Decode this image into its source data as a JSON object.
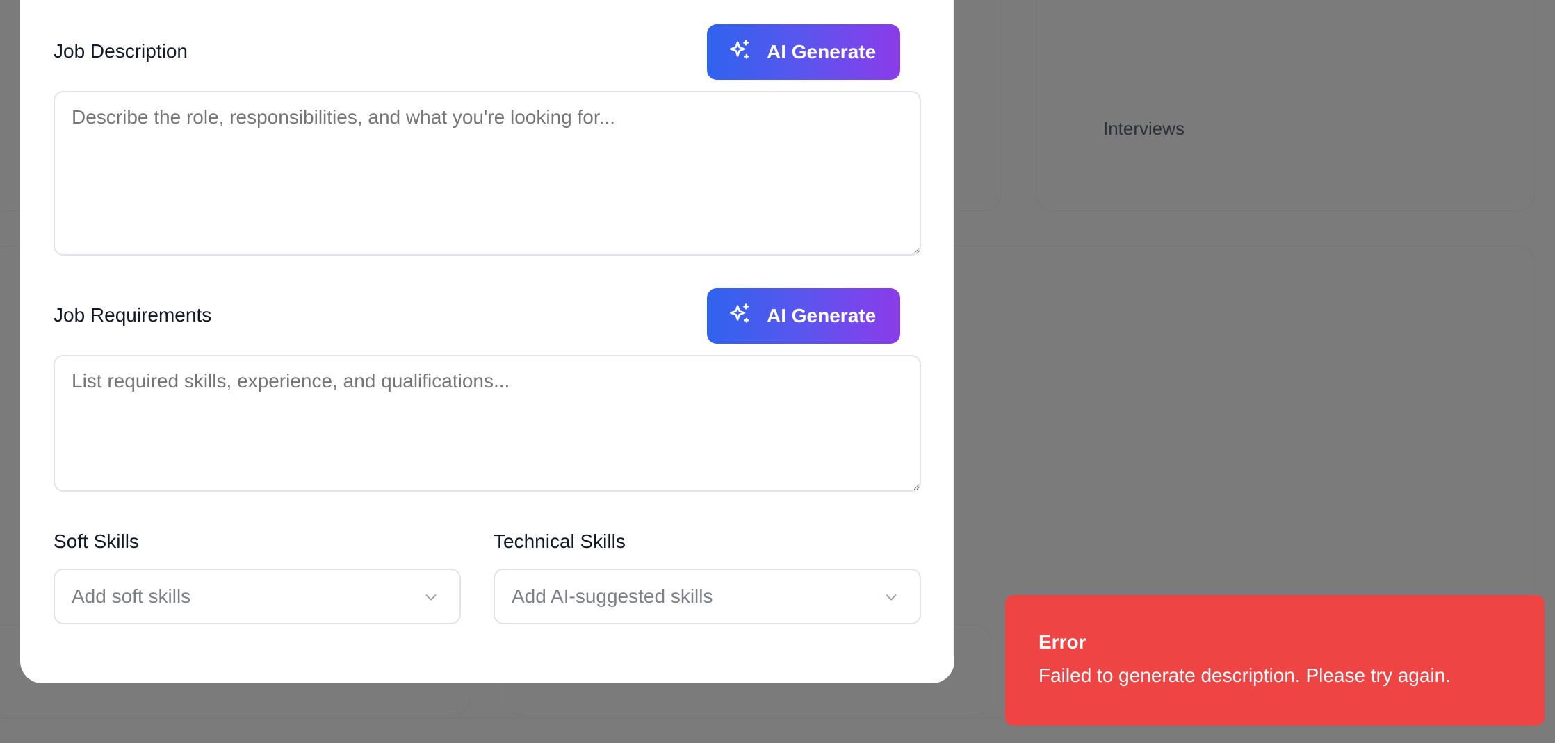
{
  "background": {
    "card_label": "Interviews"
  },
  "modal": {
    "job_description": {
      "label": "Job Description",
      "ai_button": "AI Generate",
      "placeholder": "Describe the role, responsibilities, and what you're looking for...",
      "value": ""
    },
    "job_requirements": {
      "label": "Job Requirements",
      "ai_button": "AI Generate",
      "placeholder": "List required skills, experience, and qualifications...",
      "value": ""
    },
    "soft_skills": {
      "label": "Soft Skills",
      "placeholder": "Add soft skills"
    },
    "technical_skills": {
      "label": "Technical Skills",
      "placeholder": "Add AI-suggested skills"
    }
  },
  "toast": {
    "title": "Error",
    "message": "Failed to generate description. Please try again.",
    "color": "#ef4444"
  },
  "icons": {
    "ai": "sparkles-icon",
    "dropdown": "chevron-down-icon"
  }
}
